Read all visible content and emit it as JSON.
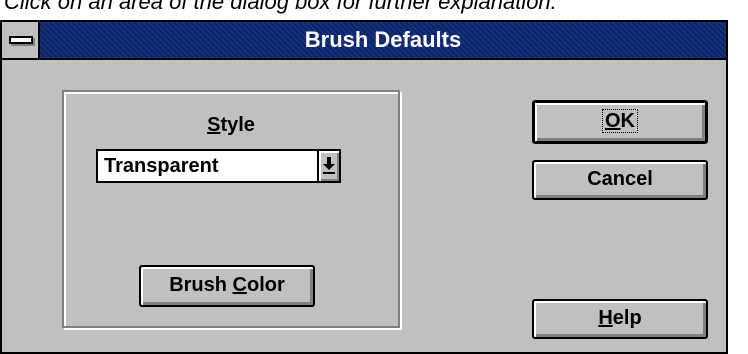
{
  "hint_text": "Click on an area of the dialog box for further explanation.",
  "window": {
    "title": "Brush Defaults",
    "system_menu_icon": "system-menu-icon"
  },
  "style_group": {
    "label_prefix": "",
    "label_mnemonic": "S",
    "label_rest": "tyle",
    "selected_value": "Transparent",
    "dropdown_icon": "dropdown-arrow-icon"
  },
  "buttons": {
    "brush_color_prefix": "Brush ",
    "brush_color_mnemonic": "C",
    "brush_color_rest": "olor",
    "ok_mnemonic": "O",
    "ok_rest": "K",
    "cancel_label": "Cancel",
    "help_mnemonic": "H",
    "help_rest": "elp"
  },
  "colors": {
    "titlebar": "#0a246a",
    "face": "#c0c0c0"
  }
}
